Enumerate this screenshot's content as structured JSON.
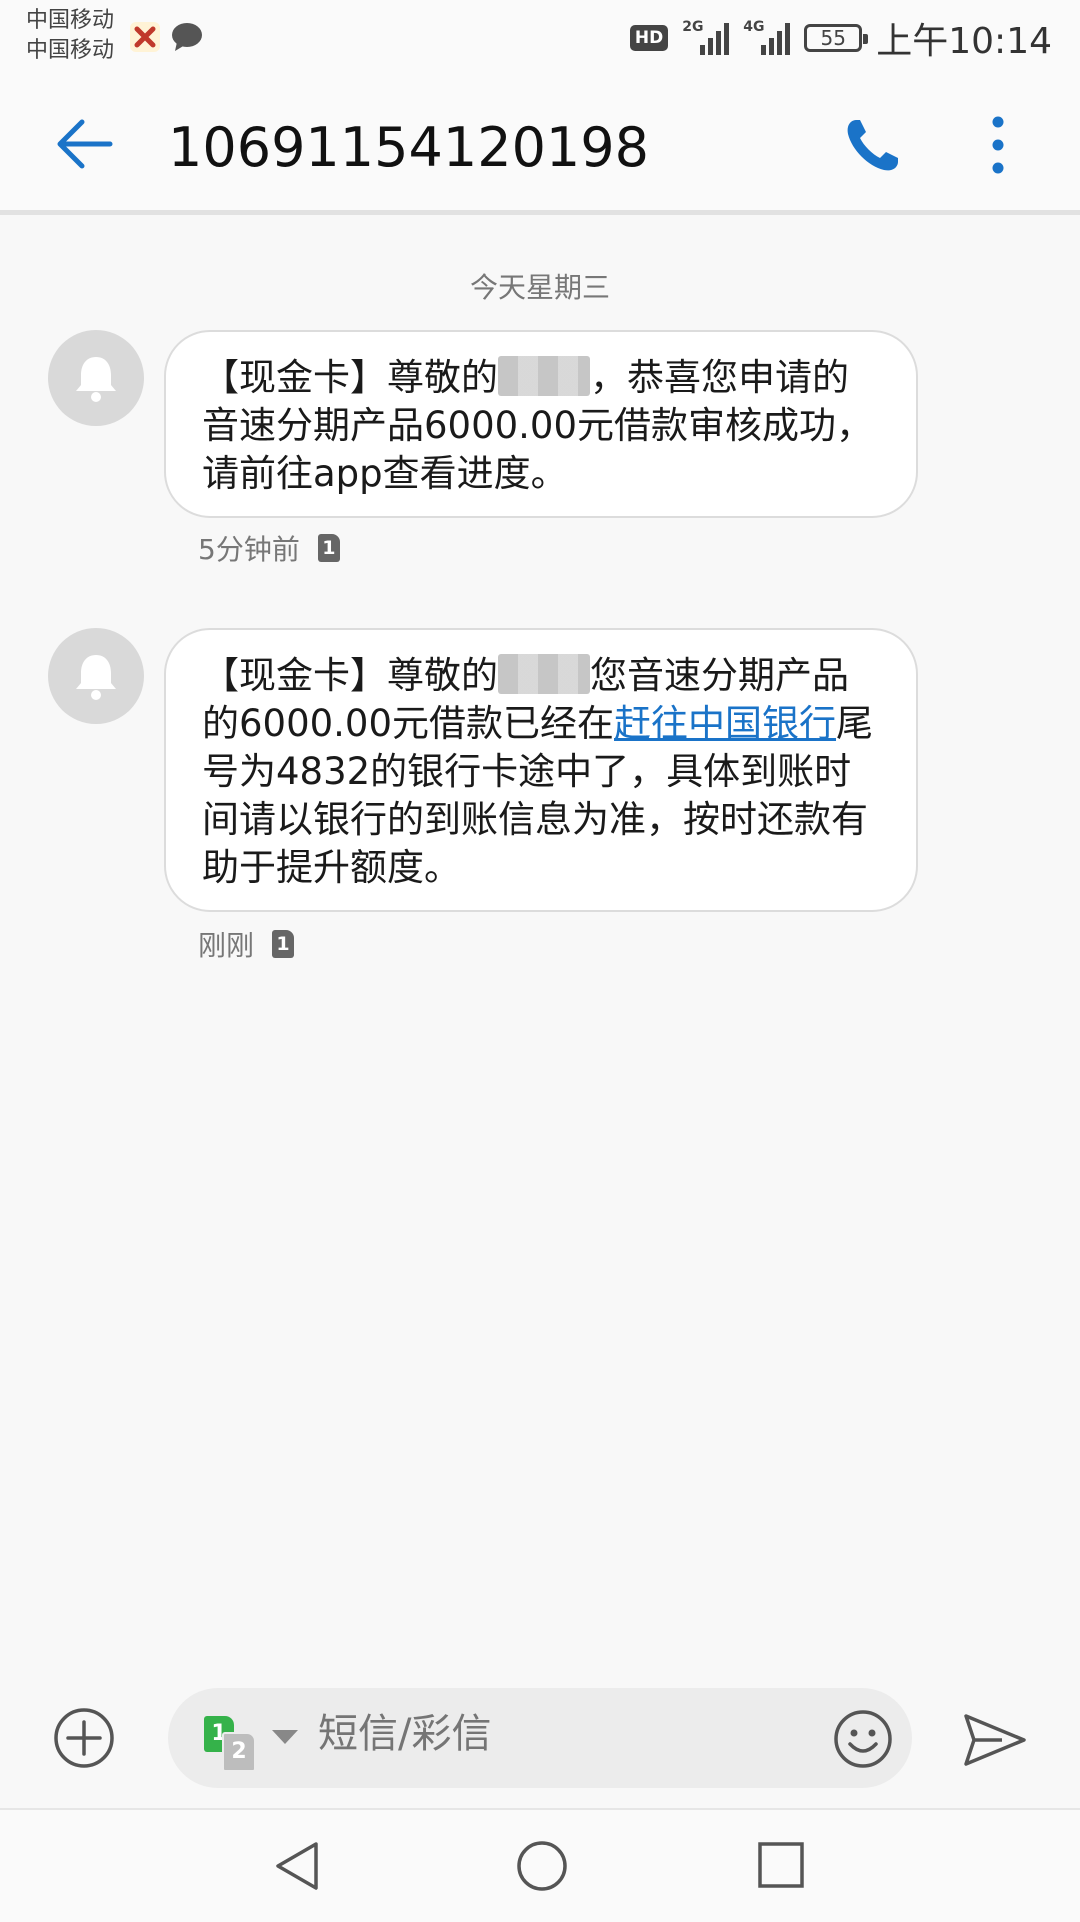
{
  "status_bar": {
    "carrier_1": "中国移动",
    "carrier_2": "中国移动",
    "hd": "HD",
    "net_1": "2G",
    "net_2": "4G",
    "battery": "55",
    "time": "上午10:14"
  },
  "header": {
    "title": "10691154120198",
    "icons": [
      "back-arrow-icon",
      "phone-icon",
      "more-vertical-icon"
    ]
  },
  "date_separator": "今天星期三",
  "messages": [
    {
      "part1": "【现金卡】尊敬的",
      "part2": "，恭喜您申请的音速分期产品6000.00元借款审核成功，请前往app查看进度。",
      "time": "5分钟前",
      "sim": "1"
    },
    {
      "part1": "【现金卡】尊敬的",
      "part2": "您音速分期产品的6000.00元借款已经在",
      "link": "赶往中国银行",
      "part3": "尾号为4832的银行卡途中了，具体到账时间请以银行的到账信息为准，按时还款有助于提升额度。",
      "time": "刚刚",
      "sim": "1"
    }
  ],
  "composer": {
    "sim_primary": "1",
    "sim_secondary": "2",
    "placeholder": "短信/彩信"
  },
  "colors": {
    "accent": "#1a73c8",
    "sim_green": "#35b24a",
    "avatar_bg": "#d9d9d9"
  }
}
